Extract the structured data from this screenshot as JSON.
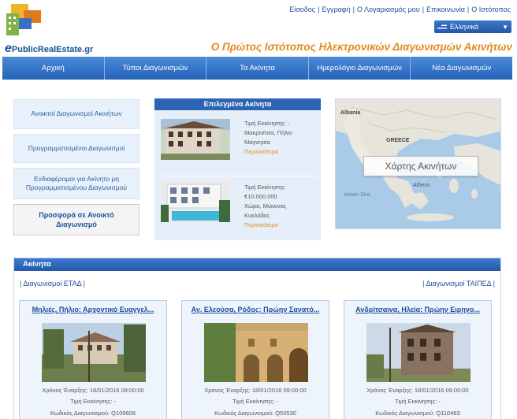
{
  "brand": {
    "name": "PublicRealEstate.gr",
    "initial": "e"
  },
  "top_links": [
    "Είσοδος",
    "Εγγραφή",
    "Ο Λογαριασμός μου",
    "Επικοινωνία",
    "Ο Ιστότοπος"
  ],
  "language": {
    "selected": "Ελληνικά",
    "flag": "greek-flag-icon"
  },
  "tagline": "Ο Πρώτος Ιστότοπος Ηλεκτρονικών Διαγωνισμών Ακινήτων",
  "nav": [
    "Αρχική",
    "Τύποι Διαγωνισμών",
    "Τα Ακίνητα",
    "Ημερολόγιο Διαγωνισμών",
    "Νέα Διαγωνισμών"
  ],
  "side_menu": [
    "Ανοικτοί Διαγωνισμοί Ακινήτων",
    "Προγραμματισμένοι Διαγωνισμοί",
    "Ενδιαφέρομαι για Ακίνητο μη Προγραμματισμένου Διαγωνισμού",
    "Προσφορά σε Ανοικτό Διαγωνισμό"
  ],
  "featured": {
    "title": "Επιλεγμένα Ακίνητα",
    "items": [
      {
        "price_label": "Τιμή Εκκίνησης: -",
        "location_1": "Μακρινίτσα, Πήλιο",
        "location_2": "Μαγνησία",
        "more": "Περισσότερα"
      },
      {
        "price_label": "Τιμή Εκκίνησης:",
        "price": "€10.000.000",
        "location_1": "Χώρα, Μύκονος",
        "location_2": "Κυκλάδες",
        "more": "Περισσότερα"
      }
    ]
  },
  "map": {
    "button": "Χάρτης Ακινήτων",
    "labels": [
      "Albania",
      "GREECE",
      "Athens",
      "Ionian Sea"
    ]
  },
  "properties": {
    "title": "Ακίνητα",
    "left_link": "| Διαγωνισμοί ΕΤΑΔ |",
    "right_link": "| Διαγωνισμοί ΤΑΙΠΕΔ |",
    "cards": [
      {
        "title": "Μηλιές, Πήλιο: Αρχοντικό Ευαγγελ...",
        "start": "Χρόνος Έναρξης: 18/01/2016 09:00:00",
        "price": "Τιμή Εκκίνησης: -",
        "code": "Κωδικός Διαγωνισμού: Q109606"
      },
      {
        "title": "Αγ. Ελεούσα, Ρόδος: Πρώην Σανατό...",
        "start": "Χρόνος Έναρξης: 18/01/2016 09:00:00",
        "price": "Τιμή Εκκίνησης: -",
        "code": "Κωδικός Διαγωνισμού: Q50530"
      },
      {
        "title": "Ανδρίτσαινα, Ηλεία: Πρώην Ειρηνο...",
        "start": "Χρόνος Έναρξης: 18/01/2016 09:00:00",
        "price": "Τιμή Εκκίνησης: -",
        "code": "Κωδικός Διαγωνισμού: Q110463"
      }
    ]
  }
}
